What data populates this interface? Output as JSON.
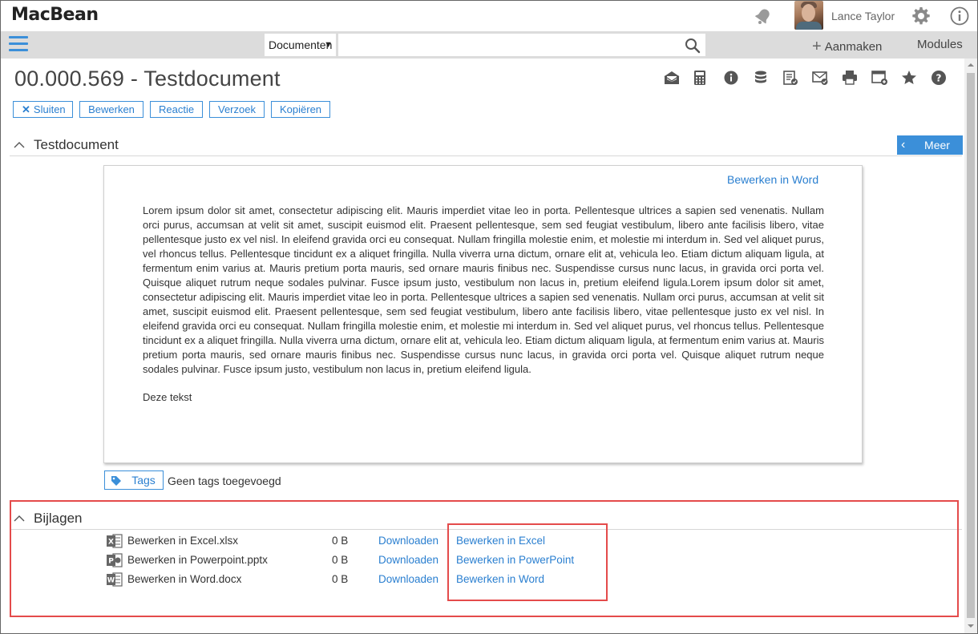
{
  "app": {
    "brand": "MacBean"
  },
  "user": {
    "name": "Lance Taylor"
  },
  "nav": {
    "search_type": "Documenten",
    "search_placeholder": "",
    "create_label": "Aanmaken",
    "modules_label": "Modules"
  },
  "page": {
    "title": "00.000.569 - Testdocument",
    "toolbar_icons": [
      "mail-open-icon",
      "calculator-icon",
      "info-icon",
      "database-icon",
      "list-check-icon",
      "mail-check-icon",
      "printer-icon",
      "window-add-icon",
      "star-icon",
      "help-icon"
    ]
  },
  "actions": {
    "close_label": "Sluiten",
    "edit_label": "Bewerken",
    "reply_label": "Reactie",
    "request_label": "Verzoek",
    "copy_label": "Kopiëren"
  },
  "document_section": {
    "title": "Testdocument",
    "more_label": "Meer",
    "edit_in_word": "Bewerken in Word",
    "body": "Lorem ipsum dolor sit amet, consectetur adipiscing elit. Mauris imperdiet vitae leo in porta. Pellentesque ultrices a sapien sed venenatis. Nullam orci purus, accumsan at velit sit amet, suscipit euismod elit. Praesent pellentesque, sem sed feugiat vestibulum, libero ante facilisis libero, vitae pellentesque justo ex vel nisl. In eleifend gravida orci eu consequat. Nullam fringilla molestie enim, et molestie mi interdum in. Sed vel aliquet purus, vel rhoncus tellus. Pellentesque tincidunt ex a aliquet fringilla. Nulla viverra urna dictum, ornare elit at, vehicula leo. Etiam dictum aliquam ligula, at fermentum enim varius at. Mauris pretium porta mauris, sed ornare mauris finibus nec. Suspendisse cursus nunc lacus, in gravida orci porta vel. Quisque aliquet rutrum neque sodales pulvinar. Fusce ipsum justo, vestibulum non lacus in, pretium eleifend ligula.Lorem ipsum dolor sit amet, consectetur adipiscing elit. Mauris imperdiet vitae leo in porta. Pellentesque ultrices a sapien sed venenatis. Nullam orci purus, accumsan at velit sit amet, suscipit euismod elit. Praesent pellentesque, sem sed feugiat vestibulum, libero ante facilisis libero, vitae pellentesque justo ex vel nisl. In eleifend gravida orci eu consequat. Nullam fringilla molestie enim, et molestie mi interdum in. Sed vel aliquet purus, vel rhoncus tellus. Pellentesque tincidunt ex a aliquet fringilla. Nulla viverra urna dictum, ornare elit at, vehicula leo. Etiam dictum aliquam ligula, at fermentum enim varius at. Mauris pretium porta mauris, sed ornare mauris finibus nec. Suspendisse cursus nunc lacus, in gravida orci porta vel. Quisque aliquet rutrum neque sodales pulvinar. Fusce ipsum justo, vestibulum non lacus in, pretium eleifend ligula.",
    "body_extra": "Deze tekst",
    "tags_label": "Tags",
    "tags_empty": "Geen tags toegevoegd"
  },
  "attachments": {
    "title": "Bijlagen",
    "items": [
      {
        "icon": "excel-file-icon",
        "name": "Bewerken in Excel.xlsx",
        "size": "0 B",
        "download": "Downloaden",
        "edit": "Bewerken in Excel"
      },
      {
        "icon": "powerpoint-file-icon",
        "name": "Bewerken in Powerpoint.pptx",
        "size": "0 B",
        "download": "Downloaden",
        "edit": "Bewerken in PowerPoint"
      },
      {
        "icon": "word-file-icon",
        "name": "Bewerken in Word.docx",
        "size": "0 B",
        "download": "Downloaden",
        "edit": "Bewerken in Word"
      }
    ]
  },
  "colors": {
    "accent": "#3b8fd9",
    "link": "#2a7fd0",
    "highlight": "#e44b4b",
    "navbar": "#dcdcdc"
  }
}
